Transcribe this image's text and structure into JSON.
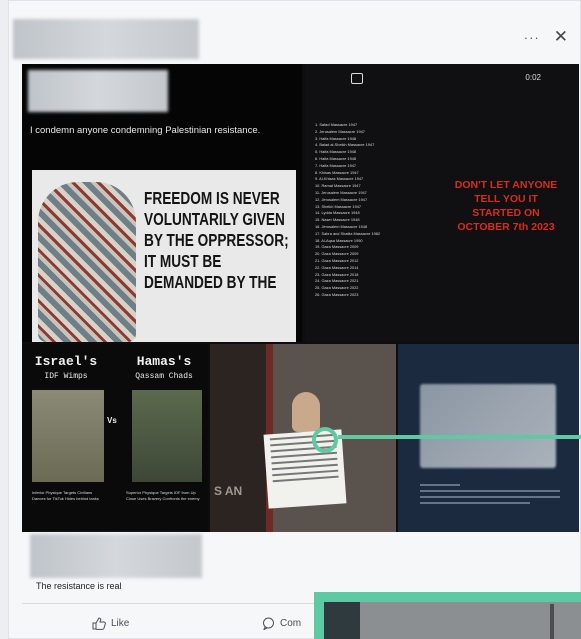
{
  "header": {
    "more_label": "···",
    "close_label": "✕"
  },
  "tile1": {
    "text": "I condemn anyone condemning Palestinian resistance.",
    "poster_lines": [
      "FREEDOM IS NEVER",
      "VOLUNTARILY GIVEN",
      "BY THE OPPRESSOR;",
      "IT MUST BE",
      "DEMANDED BY THE"
    ]
  },
  "tile2": {
    "time": "0:02",
    "list": [
      "1. Safad Massacre 1947",
      "2. Jerusalem Massacre 1947",
      "3. Haifa Massacre 1948",
      "4. Balad al-Sheikh Massacre 1947",
      "5. Haifa Massacre 1948",
      "6. Haifa Massacre 1948",
      "7. Haifa Massacre 1947",
      "8. Khisas Massacre 1947",
      "9. Al-Khisas Massacre 1947",
      "10. Ramat Massacre 1947",
      "11. Jerusalem Massacre 1947",
      "12. Jerusalem Massacre 1947",
      "13. Sheikh Massacre 1947",
      "14. Lydda Massacre 1948",
      "15. Naser Massacre 1948",
      "16. Jerusalem Massacre 1948",
      "17. Sabra and Shatila Massacre 1982",
      "18. Al-Aqsa Massacre 1990",
      "19. Gaza Massacre 2009",
      "20. Gaza Massacre 2009",
      "21. Gaza Massacre 2012",
      "22. Gaza Massacre 2014",
      "23. Gaza Massacre 2018",
      "24. Gaza Massacre 2021",
      "25. Gaza Massacre 2022",
      "26. Gaza Massacre 2023"
    ],
    "red_text": "DON'T LET ANYONE TELL YOU IT STARTED ON OCTOBER 7th 2023"
  },
  "tile3": {
    "left_title": "Israel's",
    "left_sub": "IDF Wimps",
    "right_title": "Hamas's",
    "right_sub": "Qassam Chads",
    "vs": "Vs",
    "left_caption": "Inferior Physique Targets Civilians Dances for TikTok Hides behind tanks",
    "right_caption": "Superior Physique Targets IDF from Up Close Uses Bravery Confronts the enemy"
  },
  "tile4": {
    "overlay": "S AN"
  },
  "post": {
    "text": "The resistance is real"
  },
  "actions": {
    "like": "Like",
    "comment": "Com"
  },
  "colors": {
    "highlight": "#5ec9a3",
    "red_text": "#d82b1f"
  }
}
